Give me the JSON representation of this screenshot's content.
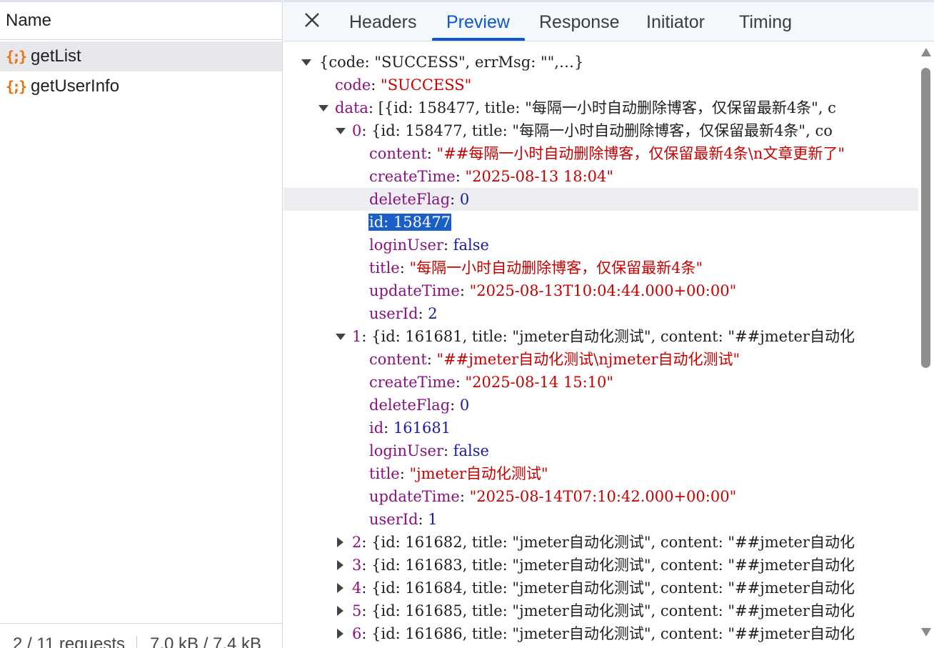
{
  "network_list": {
    "name_header": "Name",
    "requests": [
      {
        "name": "getList",
        "icon": "json-icon",
        "selected": true
      },
      {
        "name": "getUserInfo",
        "icon": "json-icon",
        "selected": false
      }
    ],
    "status": {
      "requests": "2 / 11 requests",
      "transferred": "7.0 kB / 7.4 kB"
    }
  },
  "detail_tabs": {
    "close_icon": "close-icon",
    "tabs": [
      "Headers",
      "Preview",
      "Response",
      "Initiator",
      "Timing"
    ],
    "active": "Preview"
  },
  "colors": {
    "accent": "#0b57d0",
    "key": "#881280",
    "string": "#c80000",
    "number": "#1a1aa6",
    "selection": "#1a5fc8",
    "json_icon": "#e8710a"
  },
  "preview": {
    "root_summary": "{code: \"SUCCESS\", errMsg: \"\",…}",
    "code_key": "code",
    "code_value": "\"SUCCESS\"",
    "data_key": "data",
    "data_summary": "[{id: 158477, title: \"每隔一小时自动删除博客，仅保留最新4条\", c",
    "item0": {
      "index": "0",
      "summary": "{id: 158477, title: \"每隔一小时自动删除博客，仅保留最新4条\", co",
      "fields": [
        {
          "key": "content",
          "value": "\"##每隔一小时自动删除博客，仅保留最新4条\\n文章更新了\"",
          "type": "str"
        },
        {
          "key": "createTime",
          "value": "\"2025-08-13 18:04\"",
          "type": "str"
        },
        {
          "key": "deleteFlag",
          "value": "0",
          "type": "num"
        },
        {
          "key": "id",
          "value": "158477",
          "type": "num"
        },
        {
          "key": "loginUser",
          "value": "false",
          "type": "bool"
        },
        {
          "key": "title",
          "value": "\"每隔一小时自动删除博客，仅保留最新4条\"",
          "type": "str"
        },
        {
          "key": "updateTime",
          "value": "\"2025-08-13T10:04:44.000+00:00\"",
          "type": "str"
        },
        {
          "key": "userId",
          "value": "2",
          "type": "num"
        }
      ]
    },
    "item1": {
      "index": "1",
      "summary": "{id: 161681, title: \"jmeter自动化测试\", content: \"##jmeter自动化",
      "fields": [
        {
          "key": "content",
          "value": "\"##jmeter自动化测试\\njmeter自动化测试\"",
          "type": "str"
        },
        {
          "key": "createTime",
          "value": "\"2025-08-14 15:10\"",
          "type": "str"
        },
        {
          "key": "deleteFlag",
          "value": "0",
          "type": "num"
        },
        {
          "key": "id",
          "value": "161681",
          "type": "num"
        },
        {
          "key": "loginUser",
          "value": "false",
          "type": "bool"
        },
        {
          "key": "title",
          "value": "\"jmeter自动化测试\"",
          "type": "str"
        },
        {
          "key": "updateTime",
          "value": "\"2025-08-14T07:10:42.000+00:00\"",
          "type": "str"
        },
        {
          "key": "userId",
          "value": "1",
          "type": "num"
        }
      ]
    },
    "collapsed_items": [
      {
        "index": "2",
        "summary": "{id: 161682, title: \"jmeter自动化测试\", content: \"##jmeter自动化"
      },
      {
        "index": "3",
        "summary": "{id: 161683, title: \"jmeter自动化测试\", content: \"##jmeter自动化"
      },
      {
        "index": "4",
        "summary": "{id: 161684, title: \"jmeter自动化测试\", content: \"##jmeter自动化"
      },
      {
        "index": "5",
        "summary": "{id: 161685, title: \"jmeter自动化测试\", content: \"##jmeter自动化"
      },
      {
        "index": "6",
        "summary": "{id: 161686, title: \"jmeter自动化测试\", content: \"##jmeter自动化"
      }
    ]
  }
}
